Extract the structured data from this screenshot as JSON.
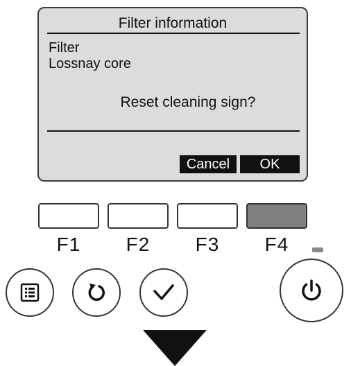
{
  "screen": {
    "title": "Filter information",
    "items": [
      "Filter",
      "Lossnay core"
    ],
    "prompt": "Reset cleaning sign?",
    "softkeys": {
      "cancel": "Cancel",
      "ok": "OK"
    }
  },
  "function_keys": [
    {
      "label": "F1",
      "active": false
    },
    {
      "label": "F2",
      "active": false
    },
    {
      "label": "F3",
      "active": false
    },
    {
      "label": "F4",
      "active": true
    }
  ],
  "buttons": {
    "menu_icon": "menu-icon",
    "return_icon": "return-icon",
    "confirm_icon": "check-icon",
    "power_icon": "power-icon"
  },
  "colors": {
    "lcd_background": "#dcdcdc",
    "softkey_background": "#111111",
    "f4_highlight": "#808080"
  }
}
